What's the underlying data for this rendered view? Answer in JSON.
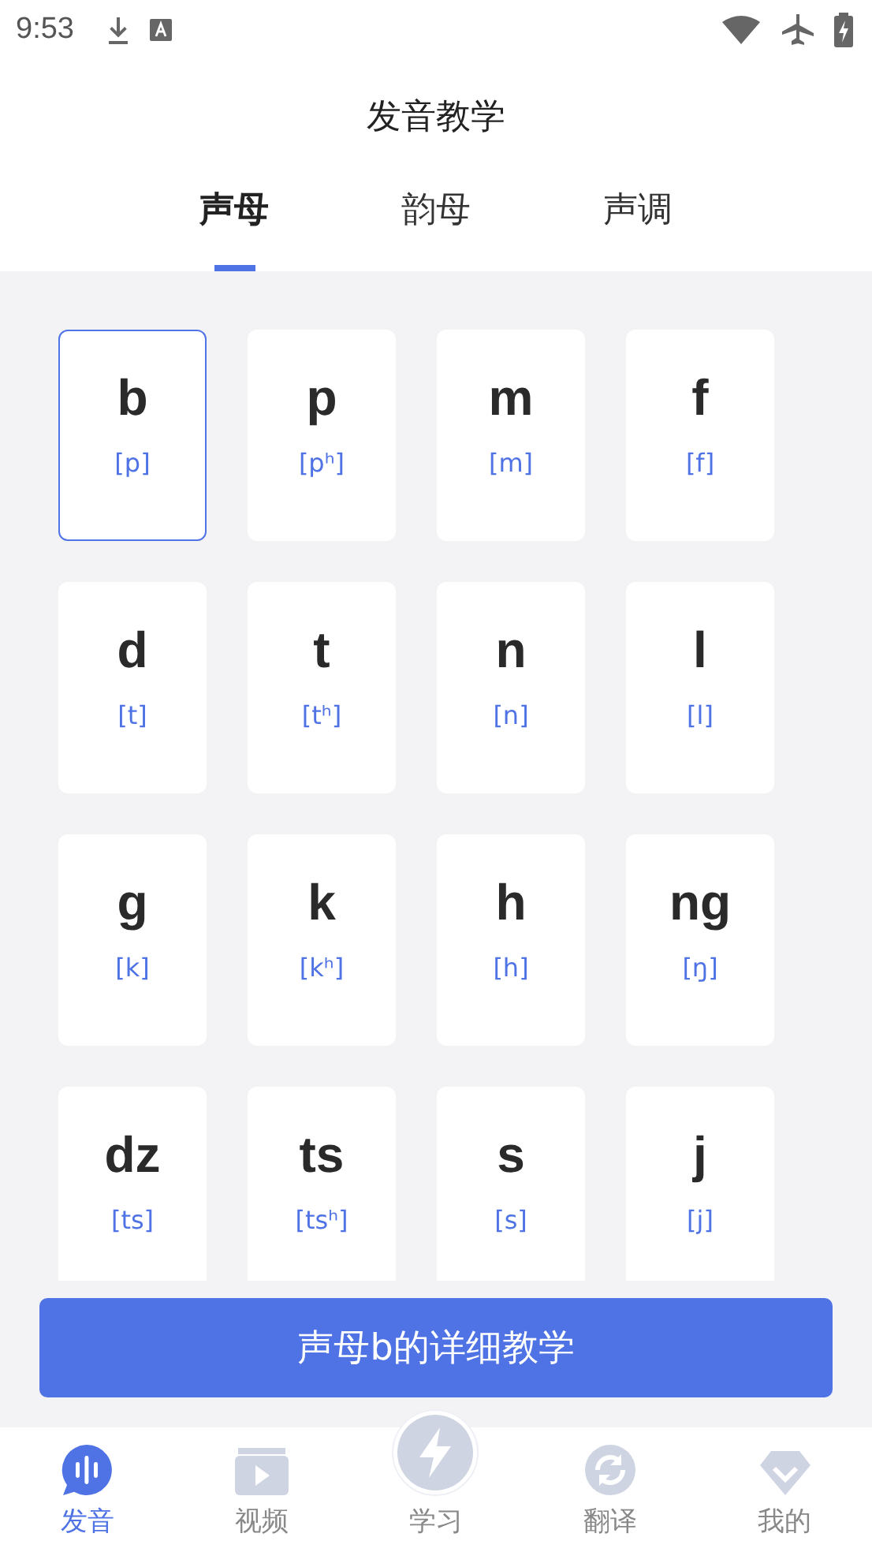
{
  "status_bar": {
    "time": "9:53"
  },
  "title": "发音教学",
  "tabs": [
    {
      "label": "声母",
      "selected": true
    },
    {
      "label": "韵母",
      "selected": false
    },
    {
      "label": "声调",
      "selected": false
    }
  ],
  "cards": [
    {
      "letter": "b",
      "ipa": "[p]",
      "selected": true
    },
    {
      "letter": "p",
      "ipa": "[pʰ]",
      "selected": false
    },
    {
      "letter": "m",
      "ipa": "[m]",
      "selected": false
    },
    {
      "letter": "f",
      "ipa": "[f]",
      "selected": false
    },
    {
      "letter": "d",
      "ipa": "[t]",
      "selected": false
    },
    {
      "letter": "t",
      "ipa": "[tʰ]",
      "selected": false
    },
    {
      "letter": "n",
      "ipa": "[n]",
      "selected": false
    },
    {
      "letter": "l",
      "ipa": "[l]",
      "selected": false
    },
    {
      "letter": "g",
      "ipa": "[k]",
      "selected": false
    },
    {
      "letter": "k",
      "ipa": "[kʰ]",
      "selected": false
    },
    {
      "letter": "h",
      "ipa": "[h]",
      "selected": false
    },
    {
      "letter": "ng",
      "ipa": "[ŋ]",
      "selected": false
    },
    {
      "letter": "dz",
      "ipa": "[ts]",
      "selected": false
    },
    {
      "letter": "ts",
      "ipa": "[tsʰ]",
      "selected": false
    },
    {
      "letter": "s",
      "ipa": "[s]",
      "selected": false
    },
    {
      "letter": "j",
      "ipa": "[j]",
      "selected": false
    }
  ],
  "detail_button": "声母b的详细教学",
  "nav": [
    {
      "kind": "voice",
      "label": "发音",
      "selected": true
    },
    {
      "kind": "video",
      "label": "视频",
      "selected": false
    },
    {
      "kind": "bolt",
      "label": "学习",
      "selected": false
    },
    {
      "kind": "refresh",
      "label": "翻译",
      "selected": false
    },
    {
      "kind": "gem",
      "label": "我的",
      "selected": false
    }
  ]
}
